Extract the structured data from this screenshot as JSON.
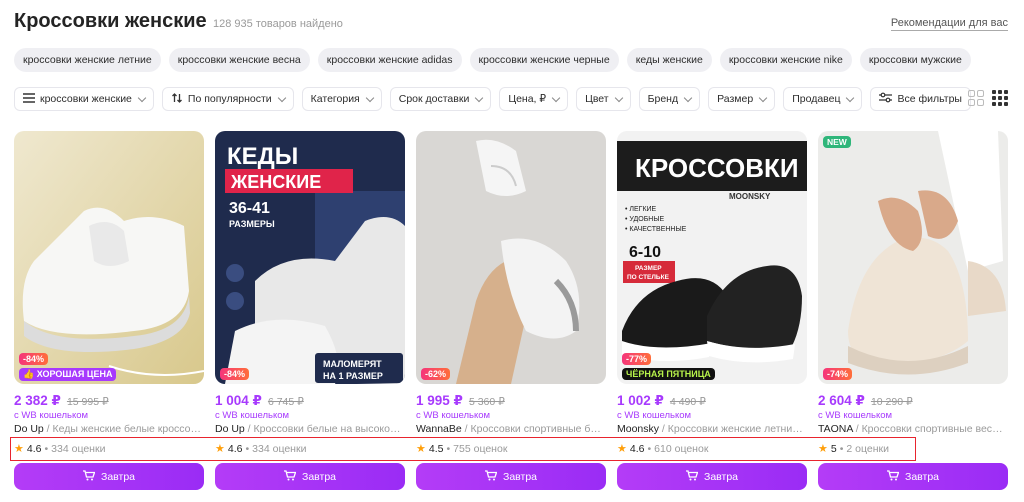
{
  "header": {
    "title": "Кроссовки женские",
    "count": "128 935 товаров найдено",
    "recommendations": "Рекомендации для вас"
  },
  "tags": [
    "кроссовки женские летние",
    "кроссовки женские весна",
    "кроссовки женские adidas",
    "кроссовки женские черные",
    "кеды женские",
    "кроссовки женские nike",
    "кроссовки мужские"
  ],
  "filters": {
    "search": "кроссовки женские",
    "sort": "По популярности",
    "category": "Категория",
    "delivery": "Срок доставки",
    "price": "Цена, ₽",
    "color": "Цвет",
    "brand": "Бренд",
    "size": "Размер",
    "seller": "Продавец",
    "all": "Все фильтры"
  },
  "common": {
    "wallet_label": "с WB кошельком",
    "cart_label": "Завтра",
    "new_badge": "NEW"
  },
  "products": [
    {
      "price": "2 382 ₽",
      "old_price": "15 995 ₽",
      "brand": "Do Up",
      "name": " / Кеды женские белые кроссовки на платформе",
      "rating": "4.6",
      "reviews": "334 оценки",
      "discount": "-84%",
      "extra_badge": "👍 ХОРОШАЯ ЦЕНА"
    },
    {
      "price": "1 004 ₽",
      "old_price": "6 745 ₽",
      "brand": "Do Up",
      "name": " / Кроссовки белые на высокой подошве",
      "rating": "4.6",
      "reviews": "334 оценки",
      "discount": "-84%",
      "image_text": {
        "line1": "КЕДЫ",
        "line2": "ЖЕНСКИЕ",
        "line3": "36-41",
        "line4": "РАЗМЕРЫ",
        "caption1": "МАЛОМЕРЯТ",
        "caption2": "НА 1 РАЗМЕР"
      }
    },
    {
      "price": "1 995 ₽",
      "old_price": "5 360 ₽",
      "brand": "WannaBe",
      "name": " / Кроссовки спортивные белые летние",
      "rating": "4.5",
      "reviews": "755 оценок",
      "discount": "-62%"
    },
    {
      "price": "1 002 ₽",
      "old_price": "4 490 ₽",
      "brand": "Moonsky",
      "name": " / Кроссовки женские летние дышащие",
      "rating": "4.6",
      "reviews": "610 оценок",
      "discount": "-77%",
      "extra_badge": "ЧЁРНАЯ ПЯТНИЦА",
      "image_text": {
        "title": "КРОССОВКИ",
        "brand_mark": "MOONSKY",
        "features": [
          "• ЛЕГКИЕ",
          "• УДОБНЫЕ",
          "• КАЧЕСТВЕННЫЕ"
        ],
        "size_range": "6-10",
        "size_note1": "РАЗМЕР",
        "size_note2": "ПО СТЕЛЬКЕ"
      }
    },
    {
      "price": "2 604 ₽",
      "old_price": "10 290 ₽",
      "brand": "TAONA",
      "name": " / Кроссовки спортивные весенние",
      "rating": "5",
      "reviews": "2 оценки",
      "discount": "-74%"
    }
  ]
}
